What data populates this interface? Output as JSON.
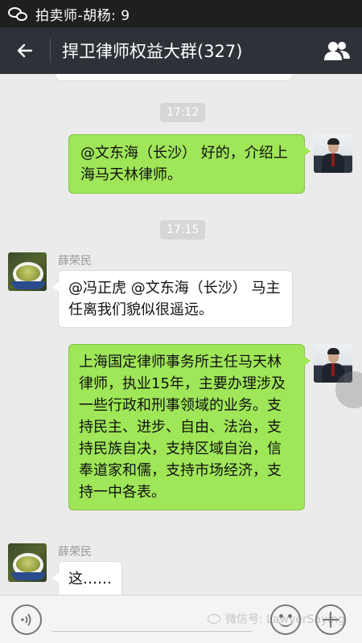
{
  "status_bar": {
    "text": "拍卖师-胡杨: 9"
  },
  "header": {
    "title": "捍卫律师权益大群(327)"
  },
  "messages": {
    "time1": "17:12",
    "msg1": {
      "text": "@文东海（长沙） 好的，介绍上海马天林律师。",
      "direction": "outgoing"
    },
    "time2": "17:15",
    "msg2": {
      "sender": "薛荣民",
      "text": "@冯正虎 @文东海（长沙） 马主任离我们貌似很遥远。",
      "direction": "incoming"
    },
    "msg3": {
      "text": "上海国定律师事务所主任马天林律师，执业15年，主要办理涉及一些行政和刑事领域的业务。支持民主、进步、自由、法治，支持民族自决，支持区域自治，信奉道家和儒，支持市场经济，支持一中各表。",
      "direction": "outgoing"
    },
    "msg4": {
      "sender": "薛荣民",
      "text": "这……",
      "direction": "incoming"
    }
  },
  "watermark": {
    "text": "微信号: LawyerSaying"
  },
  "icons": {
    "status": "wechat-icon",
    "back": "arrow-left-icon",
    "members": "people-icon",
    "voice": "voice-icon",
    "emoji": "emoji-icon",
    "more": "plus-icon"
  },
  "colors": {
    "header": "#2e3238",
    "outgoing_bubble": "#9fe658",
    "incoming_bubble": "#ffffff",
    "background": "#ebebeb"
  }
}
